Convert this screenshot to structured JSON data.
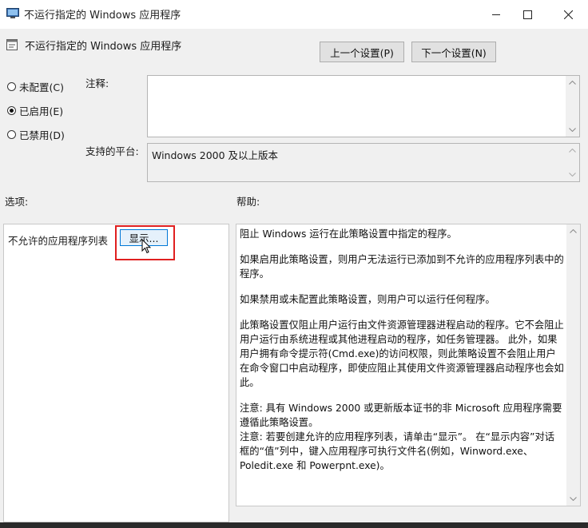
{
  "window": {
    "title": "不运行指定的 Windows 应用程序",
    "controls": {
      "minimize": "minimize-icon",
      "maximize": "maximize-icon",
      "close": "close-icon"
    }
  },
  "header": {
    "policy_name": "不运行指定的 Windows 应用程序",
    "prev_button": "上一个设置(P)",
    "next_button": "下一个设置(N)"
  },
  "state": {
    "options": [
      {
        "label": "未配置(C)",
        "selected": false
      },
      {
        "label": "已启用(E)",
        "selected": true
      },
      {
        "label": "已禁用(D)",
        "selected": false
      }
    ]
  },
  "comment": {
    "label": "注释:",
    "value": ""
  },
  "platform": {
    "label": "支持的平台:",
    "value": "Windows 2000 及以上版本"
  },
  "options_section": {
    "label": "选项:",
    "list_label": "不允许的应用程序列表",
    "show_button": "显示..."
  },
  "help_section": {
    "label": "帮助:",
    "paragraphs": [
      "阻止 Windows 运行在此策略设置中指定的程序。",
      "如果启用此策略设置，则用户无法运行已添加到不允许的应用程序列表中的程序。",
      "如果禁用或未配置此策略设置，则用户可以运行任何程序。",
      "此策略设置仅阻止用户运行由文件资源管理器进程启动的程序。它不会阻止用户运行由系统进程或其他进程启动的程序，如任务管理器。 此外，如果用户拥有命令提示符(Cmd.exe)的访问权限，则此策略设置不会阻止用户在命令窗口中启动程序，即使应阻止其使用文件资源管理器启动程序也会如此。",
      "注意: 具有 Windows 2000 或更新版本证书的非 Microsoft 应用程序需要遵循此策略设置。",
      "注意: 若要创建允许的应用程序列表，请单击“显示”。 在“显示内容”对话框的“值”列中，键入应用程序可执行文件名(例如，Winword.exe、Poledit.exe 和 Powerpnt.exe)。"
    ]
  },
  "colors": {
    "highlight_border": "#e02020",
    "accent": "#0078d7"
  }
}
